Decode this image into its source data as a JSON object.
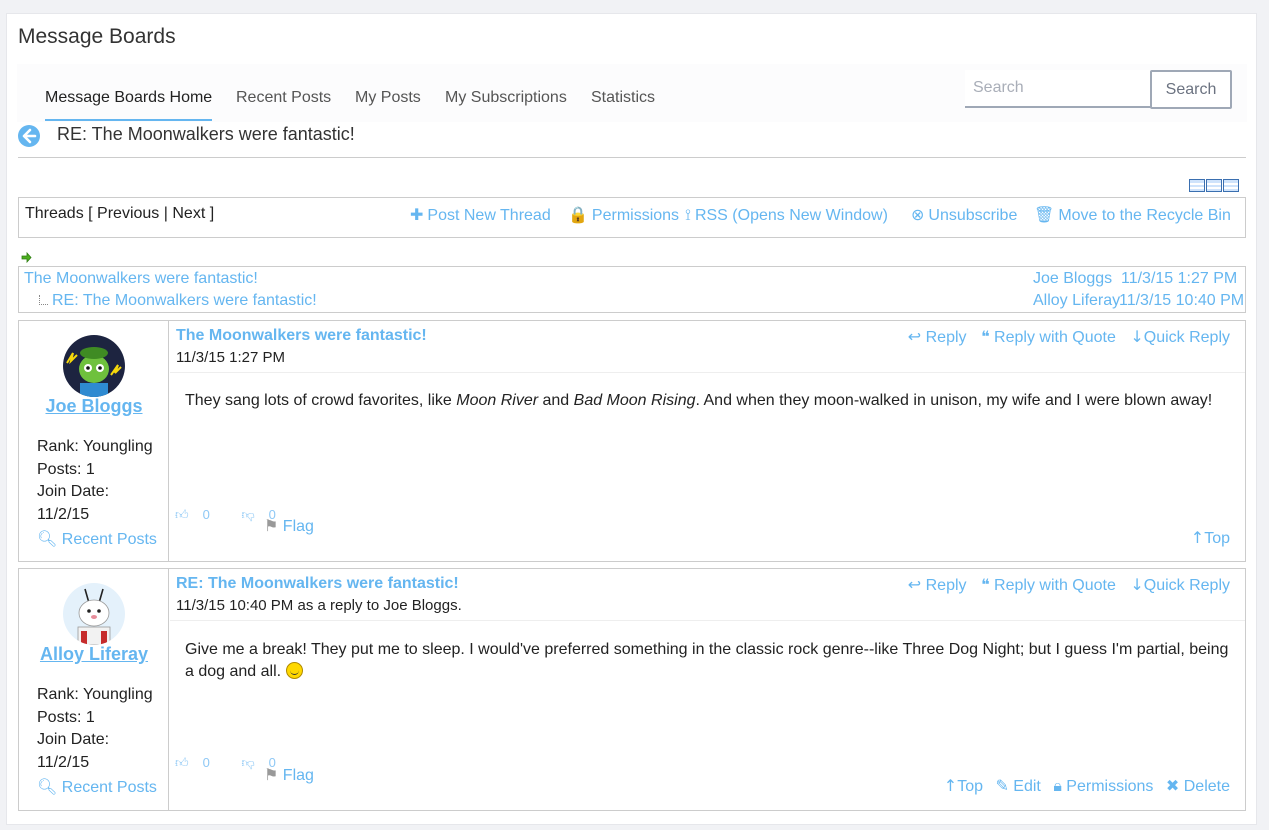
{
  "app": {
    "title": "Message Boards"
  },
  "nav": {
    "tabs": [
      {
        "label": "Message Boards Home",
        "active": true
      },
      {
        "label": "Recent Posts"
      },
      {
        "label": "My Posts"
      },
      {
        "label": "My Subscriptions"
      },
      {
        "label": "Statistics"
      }
    ],
    "search_placeholder": "Search",
    "search_button": "Search"
  },
  "thread": {
    "heading": "RE: The Moonwalkers were fantastic!"
  },
  "toolbar": {
    "threads_label": "Threads [",
    "previous": "Previous",
    "separator": "|",
    "next": "Next",
    "close_bracket": "]",
    "post_new_thread": "Post New Thread",
    "permissions": "Permissions",
    "rss": "RSS (Opens New Window)",
    "unsubscribe": "Unsubscribe",
    "recycle": "Move to the Recycle Bin"
  },
  "tree": [
    {
      "title": "The Moonwalkers were fantastic!",
      "author": "Joe Bloggs",
      "date": "11/3/15 1:27 PM"
    },
    {
      "title": "RE: The Moonwalkers were fantastic!",
      "author": "Alloy Liferay",
      "date": "11/3/15 10:40 PM"
    }
  ],
  "posts": [
    {
      "user": "Joe Bloggs",
      "rank": "Rank: Youngling",
      "posts": "Posts: 1",
      "join_label": "Join Date:",
      "join_date": "11/2/15",
      "recent_posts": "Recent Posts",
      "title": "The Moonwalkers were fantastic!",
      "date": "11/3/15 1:27 PM",
      "text_1": "They sang lots of crowd favorites, like ",
      "text_em_1": "Moon River",
      "text_2": " and ",
      "text_em_2": "Bad Moon Rising",
      "text_3": ". And when they moon-walked in unison, my wife and I were blown away!",
      "reply": "Reply",
      "reply_quote": "Reply with Quote",
      "quick_reply": "Quick Reply",
      "likes": "0",
      "dislikes": "0",
      "flag": "Flag",
      "top": "Top"
    },
    {
      "user": "Alloy Liferay",
      "rank": "Rank: Youngling",
      "posts": "Posts: 1",
      "join_label": "Join Date:",
      "join_date": "11/2/15",
      "recent_posts": "Recent Posts",
      "title": "RE: The Moonwalkers were fantastic!",
      "date": "11/3/15 10:40 PM as a reply to Joe Bloggs.",
      "text": "Give me a break! They put me to sleep. I would've preferred something in the classic rock genre--like Three Dog Night; but I guess I'm partial, being a dog and all.",
      "reply": "Reply",
      "reply_quote": "Reply with Quote",
      "quick_reply": "Quick Reply",
      "likes": "0",
      "dislikes": "0",
      "flag": "Flag",
      "top": "Top",
      "edit": "Edit",
      "permissions": "Permissions",
      "delete": "Delete"
    }
  ],
  "colors": {
    "link": "#65b6f0",
    "border": "#cccccc",
    "background": "#f1f2f5"
  }
}
